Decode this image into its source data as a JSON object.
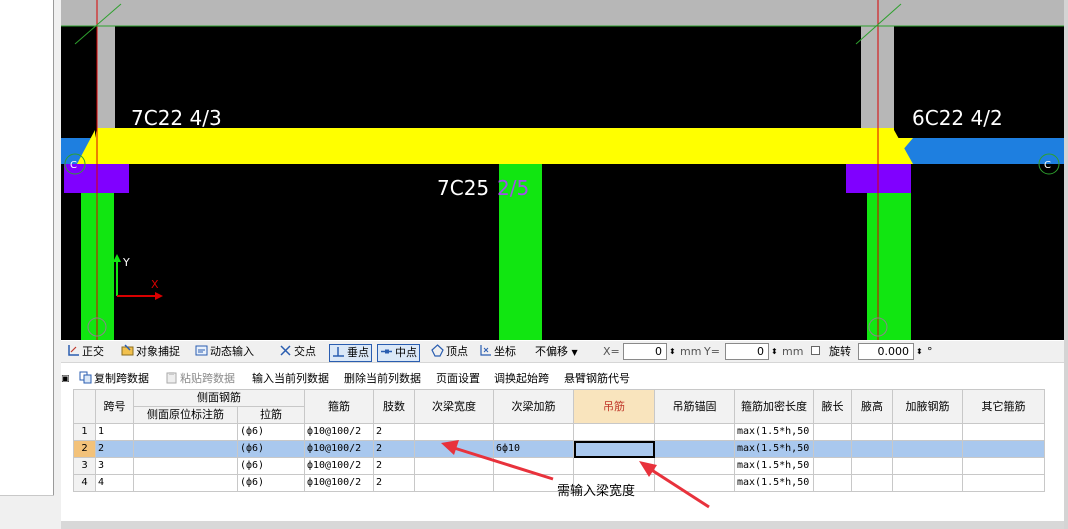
{
  "canvas": {
    "labels": {
      "top_left": "7C22 4/3",
      "top_right": "6C22 4/2",
      "bottom_white": "7C25",
      "bottom_purple": "2/5",
      "axis_y": "Y",
      "axis_x": "X",
      "marker_left": "C",
      "marker_right": "C"
    },
    "colors": {
      "background": "#000000",
      "wall": "#b7b7b7",
      "beam_top": "#ffff00",
      "beam_blue": "#1e7fe0",
      "column": "#11e611",
      "cap": "#8000ff",
      "axis_line": "#d90000"
    }
  },
  "snap_toolbar": {
    "ortho": "正交",
    "object_snap": "对象捕捉",
    "dynamic_input": "动态输入",
    "intersection": "交点",
    "perpendicular": "垂点",
    "midpoint": "中点",
    "vertex": "顶点",
    "coordinate": "坐标",
    "offset_mode": "不偏移",
    "x_label": "X=",
    "x_value": "0",
    "x_unit": "mm",
    "y_label": "Y=",
    "y_value": "0",
    "y_unit": "mm",
    "rotate_label": "旋转",
    "rotate_value": "0.000",
    "degree": "°"
  },
  "action_toolbar": {
    "copy_span": "复制跨数据",
    "paste_span": "粘贴跨数据",
    "input_column": "输入当前列数据",
    "delete_column": "删除当前列数据",
    "page_setup": "页面设置",
    "swap_start": "调换起始跨",
    "cantilever_code": "悬臂钢筋代号"
  },
  "grid": {
    "headers": {
      "span_no": "跨号",
      "side_rebar_group": "侧面钢筋",
      "side_annotation": "侧面原位标注筋",
      "tie_bar": "拉筋",
      "stirrup": "箍筋",
      "legs": "肢数",
      "secondary_beam_width": "次梁宽度",
      "secondary_reinforcement": "次梁加筋",
      "hanger_bar": "吊筋",
      "hanger_anchor": "吊筋锚固",
      "dense_length": "箍筋加密长度",
      "haunch_length": "腋长",
      "haunch_height": "腋高",
      "haunch_rebar": "加腋钢筋",
      "other_stirrup": "其它箍筋"
    },
    "rows": [
      {
        "index": "1",
        "span": "1",
        "side": "",
        "tie": "(ф6)",
        "stirrup": "ф10@100/2",
        "legs": "2",
        "sec_width": "",
        "sec_reinf": "",
        "hanger": "",
        "anchor": "",
        "dense": "max(1.5*h,50",
        "h_len": "",
        "h_height": "",
        "h_rebar": "",
        "other": ""
      },
      {
        "index": "2",
        "span": "2",
        "side": "",
        "tie": "(ф6)",
        "stirrup": "ф10@100/2",
        "legs": "2",
        "sec_width": "",
        "sec_reinf": "6ф10",
        "hanger": "",
        "anchor": "",
        "dense": "max(1.5*h,50",
        "h_len": "",
        "h_height": "",
        "h_rebar": "",
        "other": ""
      },
      {
        "index": "3",
        "span": "3",
        "side": "",
        "tie": "(ф6)",
        "stirrup": "ф10@100/2",
        "legs": "2",
        "sec_width": "",
        "sec_reinf": "",
        "hanger": "",
        "anchor": "",
        "dense": "max(1.5*h,50",
        "h_len": "",
        "h_height": "",
        "h_rebar": "",
        "other": ""
      },
      {
        "index": "4",
        "span": "4",
        "side": "",
        "tie": "(ф6)",
        "stirrup": "ф10@100/2",
        "legs": "2",
        "sec_width": "",
        "sec_reinf": "",
        "hanger": "",
        "anchor": "",
        "dense": "max(1.5*h,50",
        "h_len": "",
        "h_height": "",
        "h_rebar": "",
        "other": ""
      }
    ],
    "selected_row": 2,
    "annotation": "需输入梁宽度",
    "annotation_color": "#e8323c"
  }
}
